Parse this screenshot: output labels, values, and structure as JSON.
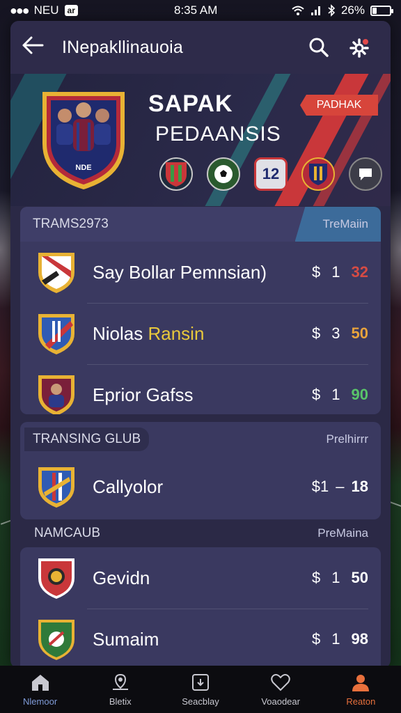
{
  "status_bar": {
    "carrier": "NEU",
    "carrier_box": "ar",
    "time": "8:35 AM",
    "battery": "26%",
    "battery_level": 0.26
  },
  "header": {
    "title": "INepakllinauoia"
  },
  "hero": {
    "title": "SAPAK",
    "subtitle": "PEDAANSIS",
    "badge": "PADHAK",
    "crest_text": "NDE",
    "icon_number": "12"
  },
  "sections": [
    {
      "title": "TRAMS2973",
      "tag": "TreMaiin",
      "rows": [
        {
          "name": "Say Bollar Pemnsian)",
          "price_symbol": "$",
          "price_a": "1",
          "price_b": "32",
          "price_color": "#d64b44"
        },
        {
          "name_a": "Niolas ",
          "name_b": "Ransin",
          "price_symbol": "$",
          "price_a": "3",
          "price_b": "50",
          "price_color": "#e8a33c"
        },
        {
          "name": "Eprior Gafss",
          "price_symbol": "$",
          "price_a": "1",
          "price_b": "90",
          "price_color": "#59c46a"
        }
      ]
    },
    {
      "title": "TRANSING GLUB",
      "tag": "Prelhirrr",
      "rows": [
        {
          "name": "Callyolor",
          "price_symbol": "$1",
          "price_a": "–",
          "price_b": "18",
          "price_color": "#ffffff"
        }
      ]
    },
    {
      "title": "NAMCAUB",
      "tag": "PreMaina",
      "rows": [
        {
          "name": "Gevidn",
          "price_symbol": "$",
          "price_a": "1",
          "price_b": "50",
          "price_color": "#ffffff"
        },
        {
          "name": "Sumaim",
          "price_symbol": "$",
          "price_a": "1",
          "price_b": "98",
          "price_color": "#ffffff"
        }
      ]
    }
  ],
  "bottom_nav": [
    {
      "label": "Nlemoor",
      "icon": "home-icon"
    },
    {
      "label": "Bletix",
      "icon": "map-pin-icon"
    },
    {
      "label": "Seacblay",
      "icon": "calendar-icon"
    },
    {
      "label": "Voaodear",
      "icon": "heart-icon"
    },
    {
      "label": "Reaton",
      "icon": "profile-icon"
    }
  ],
  "colors": {
    "accent_orange": "#e8703c",
    "badge_red": "#d7453b",
    "card_bg": "#2b2946",
    "section_bg": "#3a3960"
  }
}
